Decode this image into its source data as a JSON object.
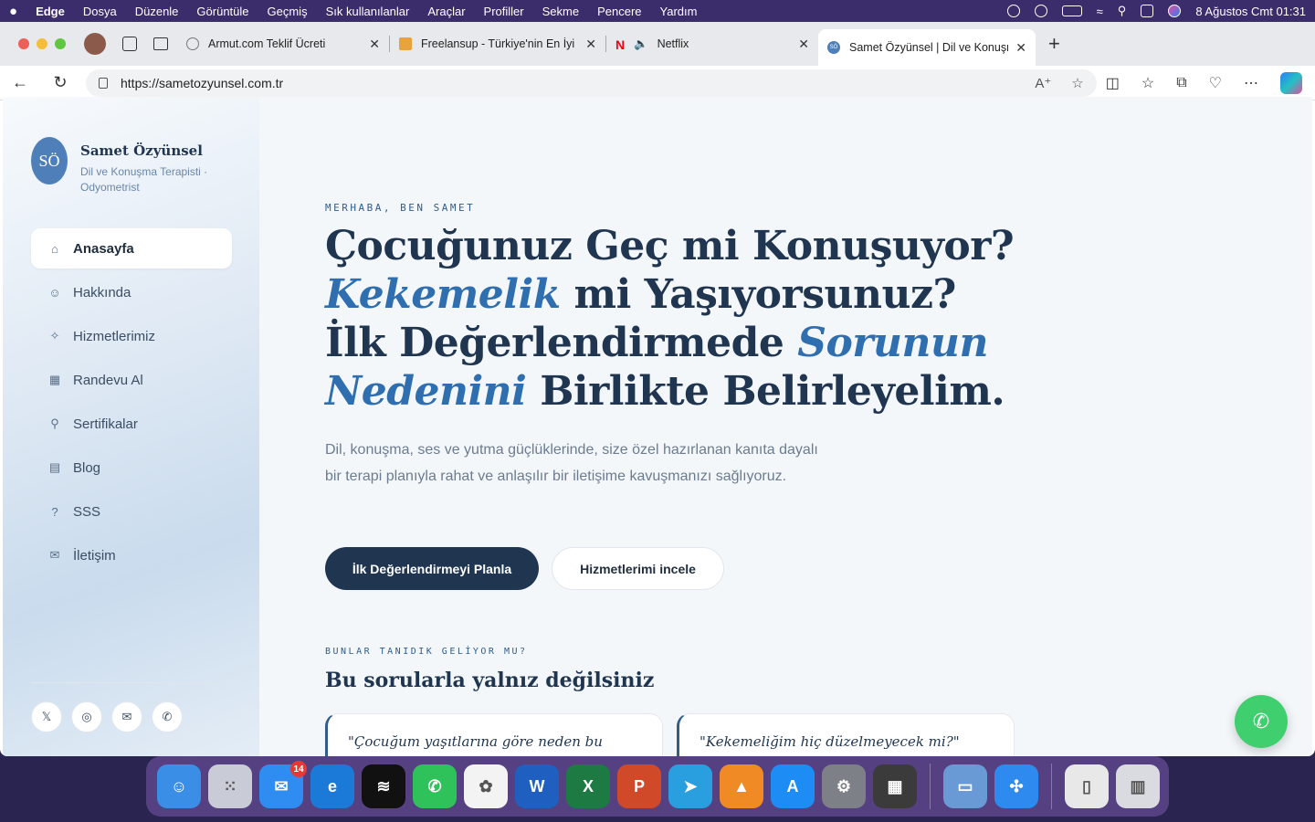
{
  "menubar": {
    "apple": "",
    "items": [
      "Edge",
      "Dosya",
      "Düzenle",
      "Görüntüle",
      "Geçmiş",
      "Sık kullanılanlar",
      "Araçlar",
      "Profiller",
      "Sekme",
      "Pencere",
      "Yardım"
    ],
    "datetime": "8 Ağustos Cmt  01:31"
  },
  "tabs": [
    {
      "title": "Armut.com Teklif Ücreti",
      "favicon_color": "#9aa3ad"
    },
    {
      "title": "Freelansup - Türkiye'nin En İyi F",
      "favicon_color": "#e8a33c"
    },
    {
      "title": "Netflix",
      "favicon_color": "#e50914",
      "favicon_text": "N"
    },
    {
      "title": "Samet Özyünsel | Dil ve Konuşm",
      "favicon_color": "#4f7fb8",
      "favicon_text": "SÖ"
    }
  ],
  "address": {
    "url": "https://sametozyunsel.com.tr"
  },
  "sidebar": {
    "avatar": "SÖ",
    "name": "Samet Özyünsel",
    "role": "Dil ve Konuşma Terapisti · Odyometrist",
    "nav": [
      {
        "label": "Anasayfa",
        "icon": "home-icon",
        "glyph": "⌂"
      },
      {
        "label": "Hakkında",
        "icon": "user-icon",
        "glyph": "☺"
      },
      {
        "label": "Hizmetlerimiz",
        "icon": "sparkle-icon",
        "glyph": "✧"
      },
      {
        "label": "Randevu Al",
        "icon": "calendar-icon",
        "glyph": "▦"
      },
      {
        "label": "Sertifikalar",
        "icon": "award-icon",
        "glyph": "⚲"
      },
      {
        "label": "Blog",
        "icon": "document-icon",
        "glyph": "▤"
      },
      {
        "label": "SSS",
        "icon": "help-icon",
        "glyph": "?"
      },
      {
        "label": "İletişim",
        "icon": "mail-icon",
        "glyph": "✉"
      }
    ],
    "socials": [
      {
        "name": "x-icon",
        "glyph": "𝕏"
      },
      {
        "name": "instagram-icon",
        "glyph": "◎"
      },
      {
        "name": "mail-icon",
        "glyph": "✉"
      },
      {
        "name": "whatsapp-icon",
        "glyph": "✆"
      }
    ]
  },
  "hero": {
    "eyebrow": "MERHABA, BEN SAMET",
    "line1": "Çocuğunuz Geç mi Konuşuyor?",
    "line2_em": "Kekemelik",
    "line2_rest": " mi Yaşıyorsunuz?",
    "line3_pre": "İlk Değerlendirmede ",
    "line3_em": "Sorunun Nedenini",
    "line3_rest": " Birlikte Belirleyelim.",
    "lead": "Dil, konuşma, ses ve yutma güçlüklerinde, size özel hazırlanan kanıta dayalı bir terapi planıyla rahat ve anlaşılır bir iletişime kavuşmanızı sağlıyoruz.",
    "primary_cta": "İlk Değerlendirmeyi Planla",
    "secondary_cta": "Hizmetlerimi incele"
  },
  "faq_section": {
    "eyebrow": "BUNLAR TANIDIK GELİYOR MU?",
    "title": "Bu sorularla yalnız değilsiniz",
    "cards": [
      "\"Çocuğum yaşıtlarına göre neden bu kadar az konuşuyor?\"",
      "\"Kekemeliğim hiç düzelmeyecek mi?\""
    ]
  },
  "dock": [
    {
      "name": "finder-icon",
      "color": "#3a8ee6",
      "glyph": "☺"
    },
    {
      "name": "launchpad-icon",
      "color": "#c9ccd6",
      "glyph": "⁙"
    },
    {
      "name": "mail-app-icon",
      "color": "#2f8cf0",
      "glyph": "✉",
      "badge": "14"
    },
    {
      "name": "edge-icon",
      "color": "#1b7ad8",
      "glyph": "e"
    },
    {
      "name": "spotify-icon",
      "color": "#111111",
      "glyph": "≋"
    },
    {
      "name": "whatsapp-app-icon",
      "color": "#2fc15a",
      "glyph": "✆"
    },
    {
      "name": "photos-icon",
      "color": "#f3f3f3",
      "glyph": "✿"
    },
    {
      "name": "word-icon",
      "color": "#1e5fbf",
      "glyph": "W"
    },
    {
      "name": "excel-icon",
      "color": "#1d7a43",
      "glyph": "X"
    },
    {
      "name": "powerpoint-icon",
      "color": "#d04a2a",
      "glyph": "P"
    },
    {
      "name": "telegram-icon",
      "color": "#2a9fe0",
      "glyph": "➤"
    },
    {
      "name": "vlc-icon",
      "color": "#f08a24",
      "glyph": "▲"
    },
    {
      "name": "appstore-icon",
      "color": "#1e8cf5",
      "glyph": "A"
    },
    {
      "name": "system-settings-icon",
      "color": "#7d8087",
      "glyph": "⚙"
    },
    {
      "name": "calculator-icon",
      "color": "#3b3b3b",
      "glyph": "▦"
    },
    {
      "name": "preview-icon",
      "color": "#6a9ad6",
      "glyph": "▭"
    },
    {
      "name": "safari-icon",
      "color": "#2f8af0",
      "glyph": "✣"
    },
    {
      "name": "document-stack-icon",
      "color": "#e8e8e8",
      "glyph": "▯"
    },
    {
      "name": "trash-icon",
      "color": "#d9dbe0",
      "glyph": "▥"
    }
  ]
}
